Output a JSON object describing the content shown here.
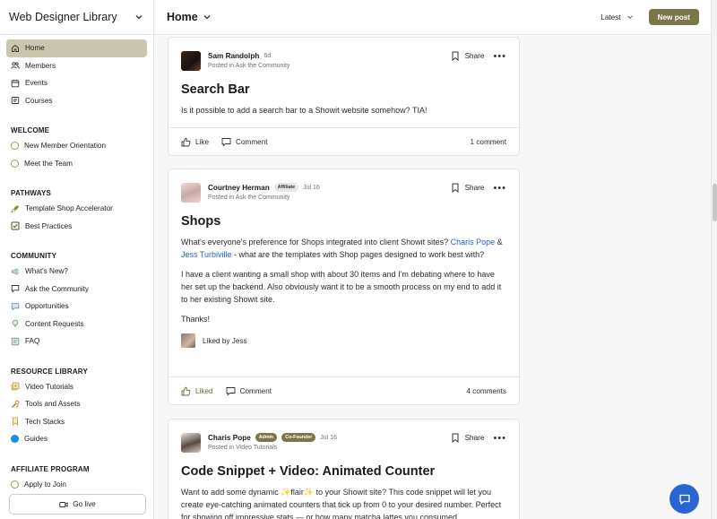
{
  "sidebar": {
    "title": "Web Designer Library",
    "nav": [
      {
        "label": "Home",
        "icon": "home-icon"
      },
      {
        "label": "Members",
        "icon": "members-icon"
      },
      {
        "label": "Events",
        "icon": "calendar-icon"
      },
      {
        "label": "Courses",
        "icon": "courses-icon"
      }
    ],
    "sections": [
      {
        "title": "WELCOME",
        "items": [
          "New Member Orientation",
          "Meet the Team"
        ]
      },
      {
        "title": "PATHWAYS",
        "items": [
          "Template Shop Accelerator",
          "Best Practices"
        ]
      },
      {
        "title": "COMMUNITY",
        "items": [
          "What's New?",
          "Ask the Community",
          "Opportunities",
          "Content Requests",
          "FAQ"
        ]
      },
      {
        "title": "RESOURCE LIBRARY",
        "items": [
          "Video Tutorials",
          "Tools and Assets",
          "Tech Stacks",
          "Guides"
        ]
      },
      {
        "title": "AFFILIATE PROGRAM",
        "items": [
          "Apply to Join"
        ]
      }
    ],
    "go_live": "Go live"
  },
  "header": {
    "title": "Home",
    "sort": "Latest",
    "new_post": "New post"
  },
  "posts": [
    {
      "author": "Sam Randolph",
      "time": "6d",
      "posted_in": "Posted in Ask the Community",
      "share": "Share",
      "title": "Search Bar",
      "body": "Is it possible to add a search bar to a Showit website somehow? TIA!",
      "like": "Like",
      "comment": "Comment",
      "comments_count": "1 comment"
    },
    {
      "author": "Courtney Herman",
      "badge": "Affiliate",
      "time": "Jul 16",
      "posted_in": "Posted in Ask the Community",
      "share": "Share",
      "title": "Shops",
      "p1_a": "What's everyone's preference for Shops integrated into client Showit sites? ",
      "mention1": "Charis Pope",
      "p1_b": " & ",
      "mention2": "Jess Turbiville",
      "p1_c": " - what are the templates with Shop pages designed to work best with?",
      "p2": "I have a client wanting a small shop with about 30 items and I'm debating where to have her set up the backend.  Also obviously want it to be a smooth process on my end to add it to her existing Showit site.",
      "p3": "Thanks!",
      "liked_by": "Liked by Jess",
      "like": "Liked",
      "comment": "Comment",
      "comments_count": "4 comments"
    },
    {
      "author": "Charis Pope",
      "badge1": "Admin",
      "badge2": "Co-Founder",
      "time": "Jul 16",
      "posted_in": "Posted in Video Tutorials",
      "share": "Share",
      "title": "Code Snippet + Video: Animated Counter",
      "body": "Want to add some dynamic ✨flair✨ to your Showit site? This code snippet will let you create eye-catching animated counters that tick up from 0 to your desired number. Perfect for showing off impressive stats — or how many matcha lattes you consumed"
    }
  ],
  "colors": {
    "accent": "#7a764a",
    "active_nav": "#c9c6ae",
    "link": "#2563c9",
    "chat": "#2a66d3"
  }
}
